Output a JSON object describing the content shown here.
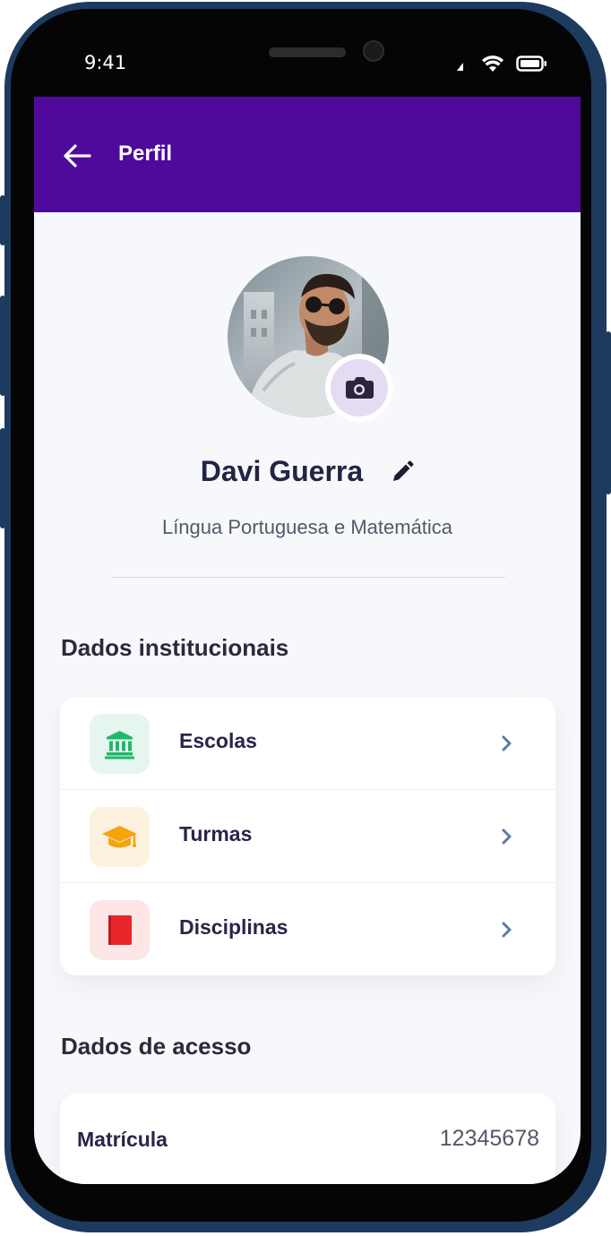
{
  "status_bar": {
    "time": "9:41",
    "icons": [
      "signal-icon",
      "wifi-icon",
      "battery-icon"
    ]
  },
  "header": {
    "title": "Perfil",
    "back_icon": "arrow-left-icon"
  },
  "profile": {
    "name": "Davi Guerra",
    "subtitle": "Língua Portuguesa e Matemática",
    "edit_icon": "pencil-icon",
    "camera_icon": "camera-icon"
  },
  "institutional": {
    "title": "Dados institucionais",
    "items": [
      {
        "label": "Escolas",
        "icon": "bank-icon",
        "icon_color": "#1fb86a",
        "icon_bg": "#e5f6ee"
      },
      {
        "label": "Turmas",
        "icon": "graduation-cap-icon",
        "icon_color": "#f5a30f",
        "icon_bg": "#fdf2df"
      },
      {
        "label": "Disciplinas",
        "icon": "book-icon",
        "icon_color": "#e8262a",
        "icon_bg": "#fce6e6"
      }
    ]
  },
  "access": {
    "title": "Dados de acesso",
    "items": [
      {
        "key": "Matrícula",
        "value": "12345678"
      }
    ]
  },
  "colors": {
    "header_bg": "#4f0a9c",
    "page_bg": "#f7f8fb",
    "chevron": "#5c7aa6"
  }
}
